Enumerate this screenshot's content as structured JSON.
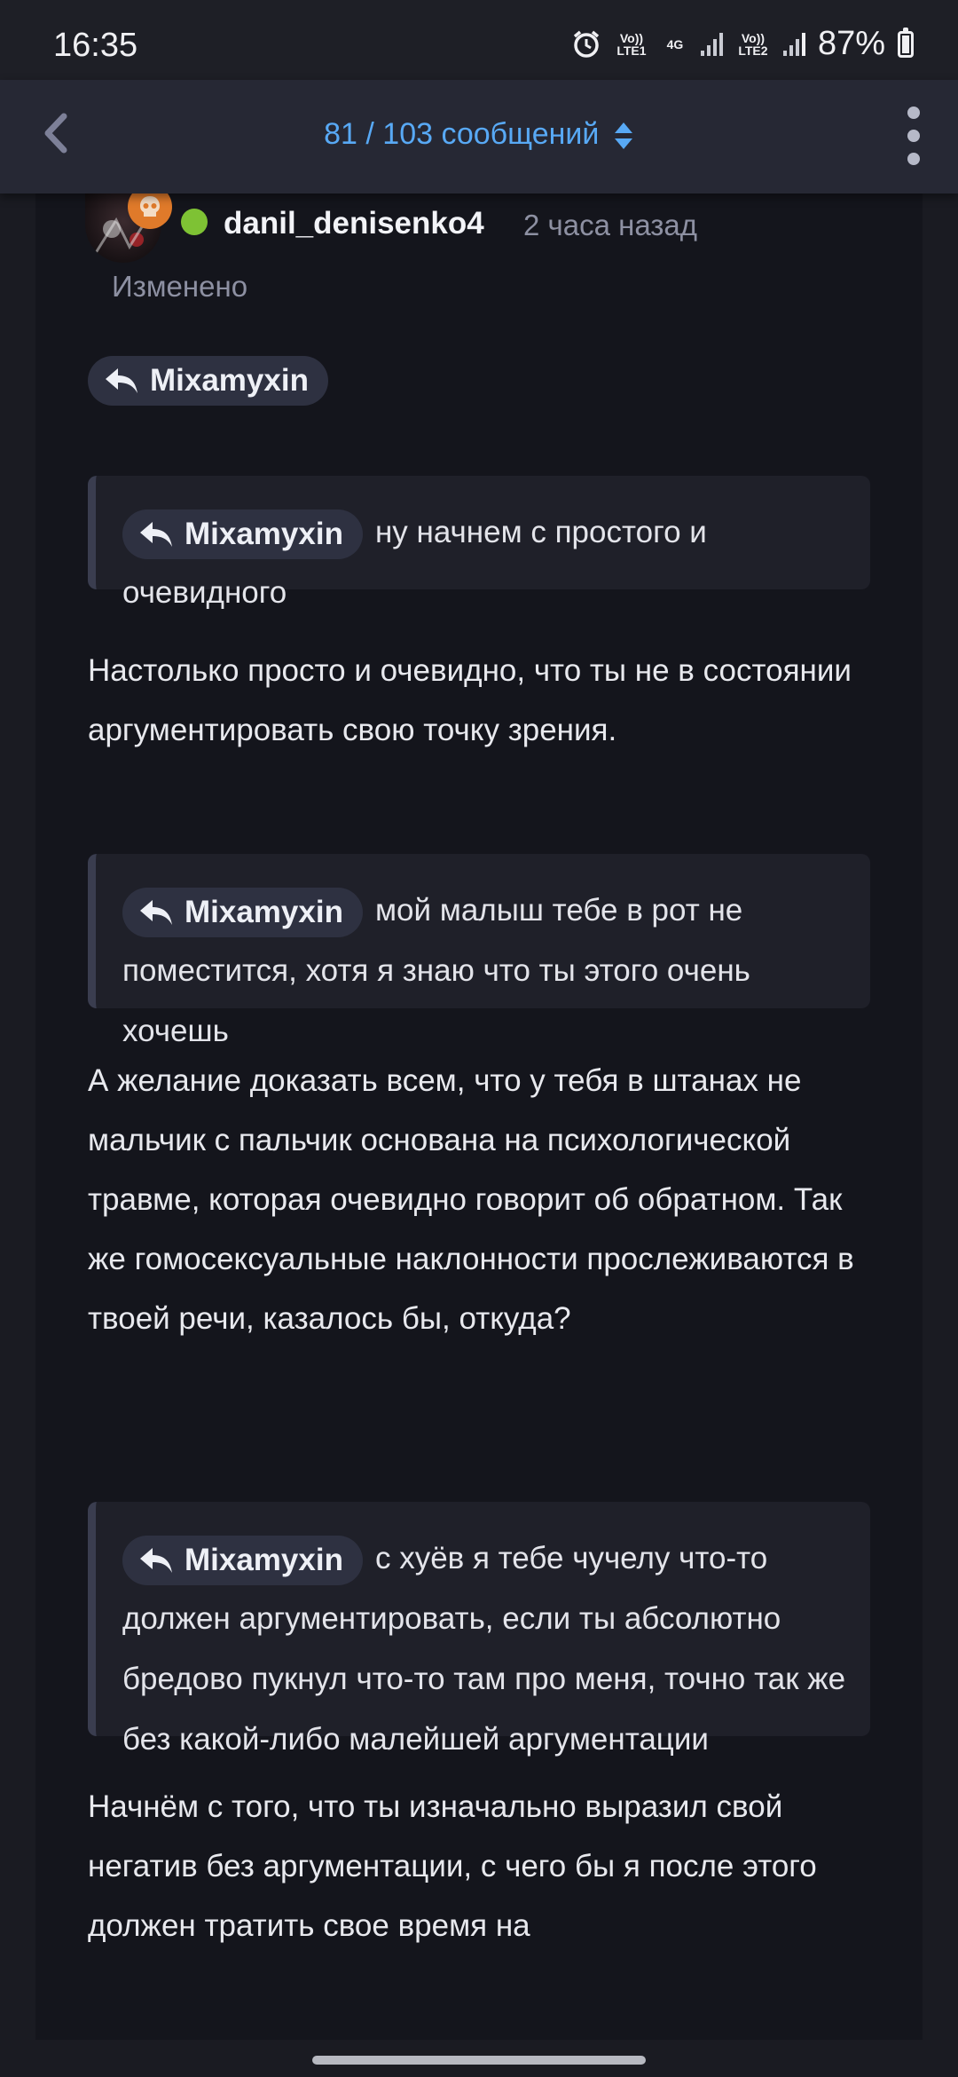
{
  "status_bar": {
    "time": "16:35",
    "sim1": "Vo)) LTE1",
    "network": "4G",
    "sim2": "Vo)) LTE2",
    "battery": "87%"
  },
  "topbar": {
    "title": "81 / 103 сообщений"
  },
  "post": {
    "author": "danil_denisenko4",
    "time": "2 часа назад",
    "edited": "Изменено",
    "mention_top": "Mixamyxin",
    "quotes": [
      {
        "mention": "Mixamyxin",
        "text": "ну начнем с простого и очевидного"
      },
      {
        "mention": "Mixamyxin",
        "text": "мой малыш тебе в рот не поместится, хотя я знаю что ты этого очень хочешь"
      },
      {
        "mention": "Mixamyxin",
        "text": "с хуёв я тебе чучелу что-то должен аргументировать, если ты абсолютно бредово пукнул что-то там про меня, точно так же без какой-либо малейшей аргументации"
      }
    ],
    "paragraphs": [
      "Настолько просто и очевидно, что ты не в состоянии аргументировать свою точку зрения.",
      "А желание доказать всем, что у тебя в штанах не мальчик с пальчик основана на психологической травме, которая очевидно говорит об обратном. Так же гомосексуальные наклонности прослеживаются в твоей речи, казалось бы, откуда?",
      "Начнём с того, что ты изначально выразил свой негатив без аргументации, с чего бы я после этого должен тратить свое время на"
    ]
  },
  "colors": {
    "accent": "#58a9f5",
    "online": "#7ec234",
    "badge": "#e07a2a"
  }
}
